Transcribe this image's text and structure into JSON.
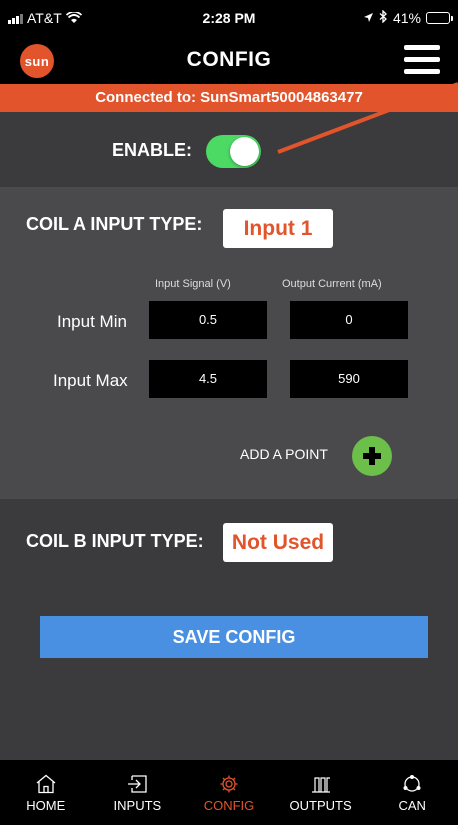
{
  "status_bar": {
    "carrier": "AT&T",
    "time": "2:28 PM",
    "battery": "41%",
    "battery_level": 0.41
  },
  "header": {
    "logo_text": "sun",
    "title": "CONFIG"
  },
  "connection": {
    "text": "Connected to: SunSmart50004863477"
  },
  "enable": {
    "label": "ENABLE:",
    "on": true
  },
  "coil_a": {
    "title": "COIL A INPUT TYPE:",
    "type": "Input 1",
    "col_input": "Input Signal (V)",
    "col_output": "Output Current (mA)",
    "rows": [
      {
        "label": "Input Min",
        "input": "0.5",
        "output": "0"
      },
      {
        "label": "Input Max",
        "input": "4.5",
        "output": "590"
      }
    ],
    "add_label": "ADD A POINT"
  },
  "coil_b": {
    "title": "COIL B INPUT TYPE:",
    "type": "Not Used"
  },
  "save_label": "SAVE CONFIG",
  "tabs": [
    {
      "label": "HOME",
      "icon": "home-icon"
    },
    {
      "label": "INPUTS",
      "icon": "inputs-icon"
    },
    {
      "label": "CONFIG",
      "icon": "gear-icon",
      "active": true
    },
    {
      "label": "OUTPUTS",
      "icon": "outputs-icon"
    },
    {
      "label": "CAN",
      "icon": "can-icon"
    }
  ],
  "colors": {
    "accent": "#e2542b",
    "toggle_on": "#4cd964",
    "save_button": "#4a90e2",
    "add_button": "#6cc04a"
  }
}
